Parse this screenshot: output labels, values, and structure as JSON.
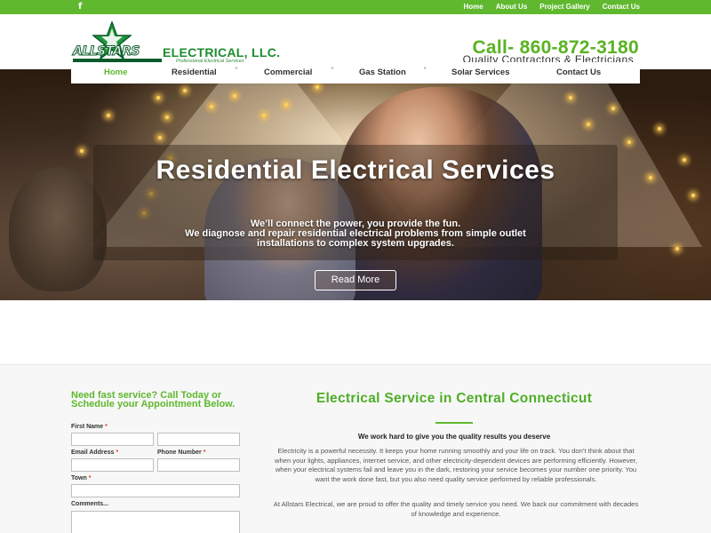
{
  "topbar": {
    "facebook_glyph": "f",
    "links": [
      "Home",
      "About Us",
      "Project Gallery",
      "Contact Us"
    ]
  },
  "header": {
    "logo_allstars": "ALLSTARS",
    "logo_name": "ELECTRICAL, LLC.",
    "logo_sub": "Professional Electrical Services",
    "call": "Call- 860-872-3180",
    "tagline": "Quality Contractors & Electricians"
  },
  "nav": {
    "items": [
      {
        "label": "Home"
      },
      {
        "label": "Residential"
      },
      {
        "label": "Commercial"
      },
      {
        "label": "Gas Station"
      },
      {
        "label": "Solar Services"
      },
      {
        "label": "Contact Us"
      }
    ],
    "chevron": "˅"
  },
  "hero": {
    "title": "Residential Electrical Services",
    "sub1": "We’ll connect the power, you provide the fun.",
    "sub2": "We diagnose and repair residential electrical problems from simple outlet",
    "sub3": "installations to complex system upgrades.",
    "button": "Read More"
  },
  "form": {
    "title": "Need fast service? Call Today or Schedule your Appointment Below.",
    "first_name": "First Name",
    "email": "Email Address",
    "phone": "Phone Number",
    "town": "Town",
    "comments": "Comments...",
    "required_mark": "*"
  },
  "content": {
    "title": "Electrical Service in Central Connecticut",
    "subtitle": "We work hard to give you the quality results you deserve",
    "para1": "Electricity is a powerful necessity. It keeps your home running smoothly and your life on track. You don’t think about that when your lights, appliances, internet service, and other electricity-dependent devices are performing efficiently. However, when your electrical systems fail and leave you in the dark, restoring your service becomes your number one priority. You want the work done fast, but you also need quality service performed by reliable professionals.",
    "para2": "At Allstars Electrical, we are proud to offer the quality and timely service you need. We back our commitment with decades of knowledge and experience."
  },
  "colors": {
    "brand_green": "#5fb82e",
    "logo_dark_green": "#0a5b2a"
  }
}
